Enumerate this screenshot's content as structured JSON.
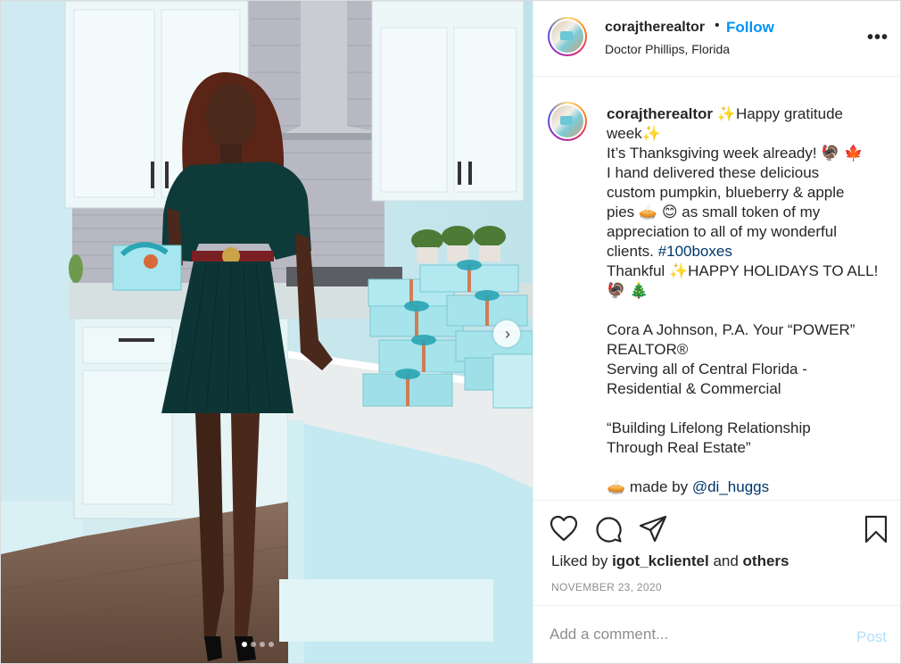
{
  "post": {
    "username": "corajtherealtor",
    "follow_label": "Follow",
    "location": "Doctor Phillips, Florida",
    "more_label": "•••"
  },
  "caption": {
    "username": "corajtherealtor",
    "lines": {
      "l1": "Happy gratitude",
      "l2": "week",
      "l3": "It’s Thanksgiving week already!",
      "l4": "I hand delivered these delicious",
      "l5": "custom pumpkin, blueberry & apple",
      "l6": "pies",
      "l6b": "as small token of my",
      "l7": "appreciation to all of my wonderful",
      "l8": "clients.",
      "hashtag": "#100boxes",
      "l9": "Thankful",
      "l9b": "HAPPY HOLIDAYS TO ALL!",
      "l11": "Cora A Johnson, P.A. Your “POWER”",
      "l12": "REALTOR®",
      "l13": "Serving all of Central Florida -",
      "l14": "Residential & Commercial",
      "l16": "“Building Lifelong Relationship",
      "l17": "Through Real Estate”",
      "l19": "made by",
      "mention": "@di_huggs"
    },
    "emojis": {
      "sparkles": "✨",
      "turkey": "🦃",
      "maple_leaf": "🍁",
      "pie": "🥧",
      "smile": "😊",
      "tree": "🎄"
    }
  },
  "actions": {
    "liked_prefix": "Liked by",
    "liked_user": "igot_kclientel",
    "liked_and": "and",
    "liked_others": "others",
    "date": "NOVEMBER 23, 2020"
  },
  "comment": {
    "placeholder": "Add a comment...",
    "post_label": "Post"
  },
  "carousel": {
    "dots": 4,
    "active_index": 0,
    "next_icon": "›"
  },
  "colors": {
    "link_blue": "#0095f6",
    "hashtag_blue": "#00376b",
    "muted": "#8e8e8e",
    "post_disabled": "#b2dffc"
  }
}
